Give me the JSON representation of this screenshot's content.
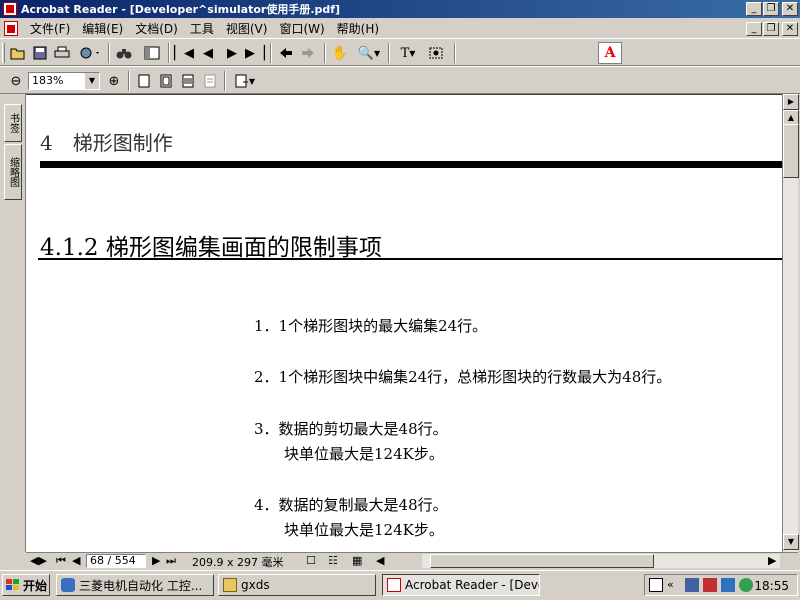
{
  "window": {
    "title": "Acrobat Reader - [Developer^simulator使用手册.pdf]",
    "minimize": "_",
    "restore": "❐",
    "close": "✕"
  },
  "menu": [
    "文件(F)",
    "编辑(E)",
    "文档(D)",
    "工具",
    "视图(V)",
    "窗口(W)",
    "帮助(H)"
  ],
  "toolbar2": {
    "zoom_value": "183%"
  },
  "nav_tabs": [
    "书签",
    "缩略图"
  ],
  "document": {
    "chapter_title": "4　梯形图制作",
    "section_title": "4.1.2 梯形图编集画面的限制事项",
    "items": [
      "1．1个梯形图块的最大编集24行。",
      "2．1个梯形图块中编集24行，总梯形图块的行数最大为48行。",
      "3．数据的剪切最大是48行。",
      "　　块单位最大是124K步。",
      "4．数据的复制最大是48行。",
      "　　块单位最大是124K步。"
    ]
  },
  "statusbar": {
    "page_field": "68 / 554",
    "page_size": "209.9 x 297 毫米"
  },
  "taskbar": {
    "start_label": "开始",
    "tasks": [
      "三菱电机自动化 工控...",
      "gxds",
      "Acrobat Reader - [Devel..."
    ],
    "clock": "18:55"
  },
  "icons": {
    "open": "folder-open-icon",
    "save": "save-icon",
    "print": "print-icon",
    "find": "binoculars-icon",
    "hand": "hand-tool-icon",
    "zoom": "zoom-in-icon"
  },
  "colors": {
    "titlebar": "#0a246a",
    "adobe": "#e00000"
  }
}
